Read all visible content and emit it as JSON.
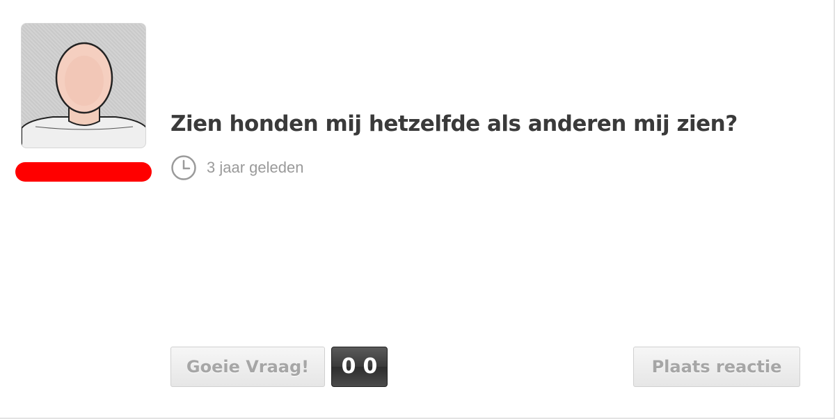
{
  "question": {
    "title": "Zien honden mij hetzelfde als anderen mij zien?",
    "time_ago": "3 jaar geleden"
  },
  "user": {
    "avatar_icon": "default-user-avatar",
    "name_redacted": true,
    "redaction_color": "#ff0000"
  },
  "actions": {
    "goed_label": "Goeie Vraag!",
    "vote_count_digits": [
      "0",
      "0"
    ],
    "react_label": "Plaats reactie"
  },
  "icons": {
    "time": "clock-icon"
  }
}
